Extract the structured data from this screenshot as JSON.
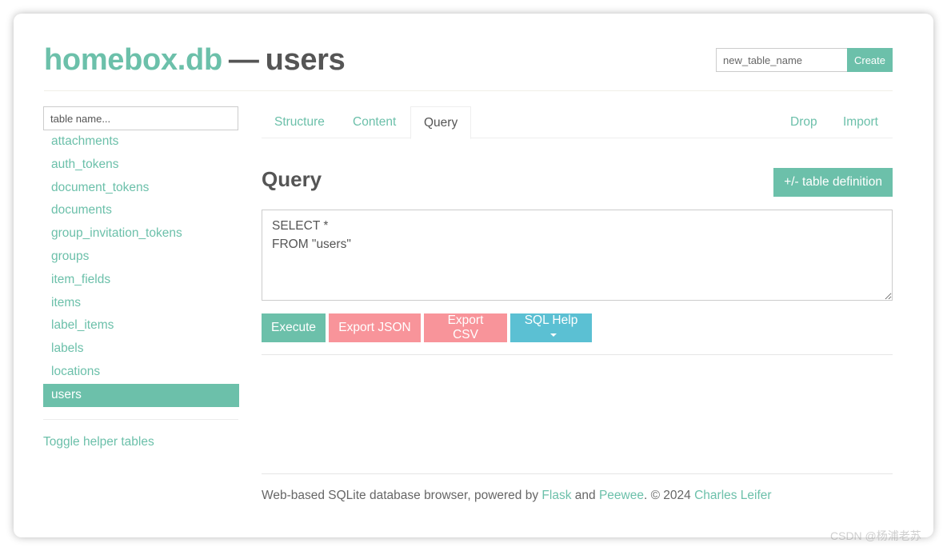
{
  "header": {
    "db_name": "homebox.db",
    "separator": "—",
    "table_name": "users"
  },
  "create_table": {
    "input_placeholder": "new_table_name",
    "input_value": "",
    "button_label": "Create"
  },
  "sidebar": {
    "filter_placeholder": "table name...",
    "filter_value": "",
    "tables": [
      {
        "label": "attachments",
        "active": false
      },
      {
        "label": "auth_tokens",
        "active": false
      },
      {
        "label": "document_tokens",
        "active": false
      },
      {
        "label": "documents",
        "active": false
      },
      {
        "label": "group_invitation_tokens",
        "active": false
      },
      {
        "label": "groups",
        "active": false
      },
      {
        "label": "item_fields",
        "active": false
      },
      {
        "label": "items",
        "active": false
      },
      {
        "label": "label_items",
        "active": false
      },
      {
        "label": "labels",
        "active": false
      },
      {
        "label": "locations",
        "active": false
      },
      {
        "label": "users",
        "active": true
      }
    ],
    "toggle_helper_label": "Toggle helper tables"
  },
  "tabs": {
    "structure": "Structure",
    "content": "Content",
    "query": "Query",
    "drop": "Drop",
    "import": "Import",
    "active": "Query"
  },
  "query": {
    "title": "Query",
    "table_definition_label": "+/- table definition",
    "sql": "SELECT *\nFROM \"users\"",
    "buttons": {
      "execute": "Execute",
      "export_json": "Export JSON",
      "export_csv": "Export CSV",
      "sql_help": "SQL Help"
    }
  },
  "footer": {
    "text_prefix": "Web-based SQLite database browser, powered by ",
    "flask": "Flask",
    "and": " and ",
    "peewee": "Peewee",
    "copyright": ". © 2024 ",
    "author": "Charles Leifer"
  },
  "watermark": "CSDN @杨浦老苏",
  "colors": {
    "accent": "#6cc0aa",
    "danger": "#f8949a",
    "info": "#5bc0d3",
    "text": "#555555"
  }
}
